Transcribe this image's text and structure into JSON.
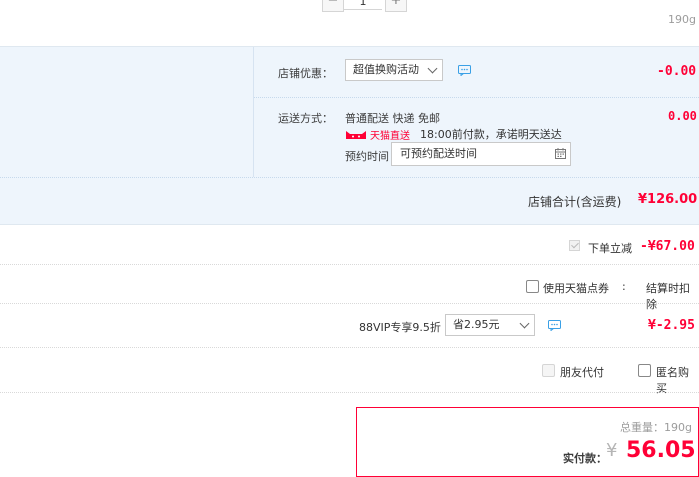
{
  "product": {
    "quantity": "1",
    "weight": "190g"
  },
  "shop": {
    "discount_label": "店铺优惠：",
    "discount_selected": "超值换购活动",
    "discount_amount": "-0.00",
    "shipping_label": "运送方式：",
    "shipping_method": "普通配送 快递 免邮",
    "tmall_badge": "天猫直送",
    "shipping_promise": "18:00前付款，承诺明天送达",
    "booking_label": "预约时间",
    "booking_placeholder": "可预约配送时间",
    "shipping_amount": "0.00",
    "subtotal_label": "店铺合计(含运费)",
    "subtotal_amount": "¥126.00"
  },
  "instant_discount": {
    "label": "下单立减",
    "amount": "-¥67.00"
  },
  "coupon": {
    "label": "使用天猫点券",
    "colon": ":",
    "settle_text": "结算时扣除"
  },
  "vip": {
    "label": "88VIP专享9.5折",
    "selected": "省2.95元",
    "amount": "¥-2.95"
  },
  "options": {
    "friend_pay": "朋友代付",
    "anonymous": "匿名购买"
  },
  "total": {
    "weight_text": "总重量：190g",
    "pay_label": "实付款：",
    "currency": "¥",
    "amount": "56.05"
  },
  "colors": {
    "accent_red": "#ff0036",
    "panel_blue": "#eef5fc"
  }
}
